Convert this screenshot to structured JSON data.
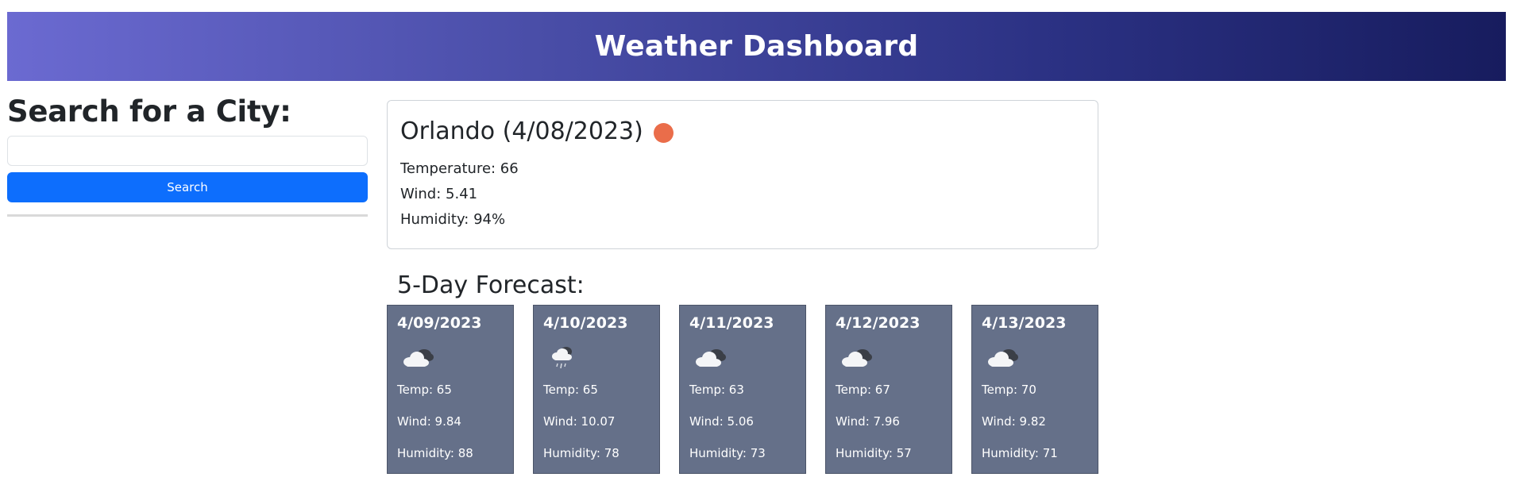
{
  "header": {
    "title": "Weather Dashboard",
    "gradient_start": "#6b6ad1",
    "gradient_end": "#171c5e"
  },
  "search": {
    "heading": "Search for a City:",
    "input_value": "",
    "button_label": "Search",
    "button_color": "#0d6efd"
  },
  "current": {
    "title": "Orlando (4/08/2023)",
    "icon": "sun-icon",
    "icon_color": "#ea6d4a",
    "temperature": "Temperature: 66",
    "wind": "Wind: 5.41",
    "humidity": "Humidity: 94%"
  },
  "forecast": {
    "heading": "5-Day Forecast:",
    "card_color": "#657089",
    "days": [
      {
        "date": "4/09/2023",
        "icon": "cloudy-icon",
        "temp": "Temp: 65",
        "wind": "Wind: 9.84",
        "humidity": "Humidity: 88"
      },
      {
        "date": "4/10/2023",
        "icon": "rain-cloud-icon",
        "temp": "Temp: 65",
        "wind": "Wind: 10.07",
        "humidity": "Humidity: 78"
      },
      {
        "date": "4/11/2023",
        "icon": "cloudy-icon",
        "temp": "Temp: 63",
        "wind": "Wind: 5.06",
        "humidity": "Humidity: 73"
      },
      {
        "date": "4/12/2023",
        "icon": "cloudy-icon",
        "temp": "Temp: 67",
        "wind": "Wind: 7.96",
        "humidity": "Humidity: 57"
      },
      {
        "date": "4/13/2023",
        "icon": "cloudy-icon",
        "temp": "Temp: 70",
        "wind": "Wind: 9.82",
        "humidity": "Humidity: 71"
      }
    ]
  }
}
